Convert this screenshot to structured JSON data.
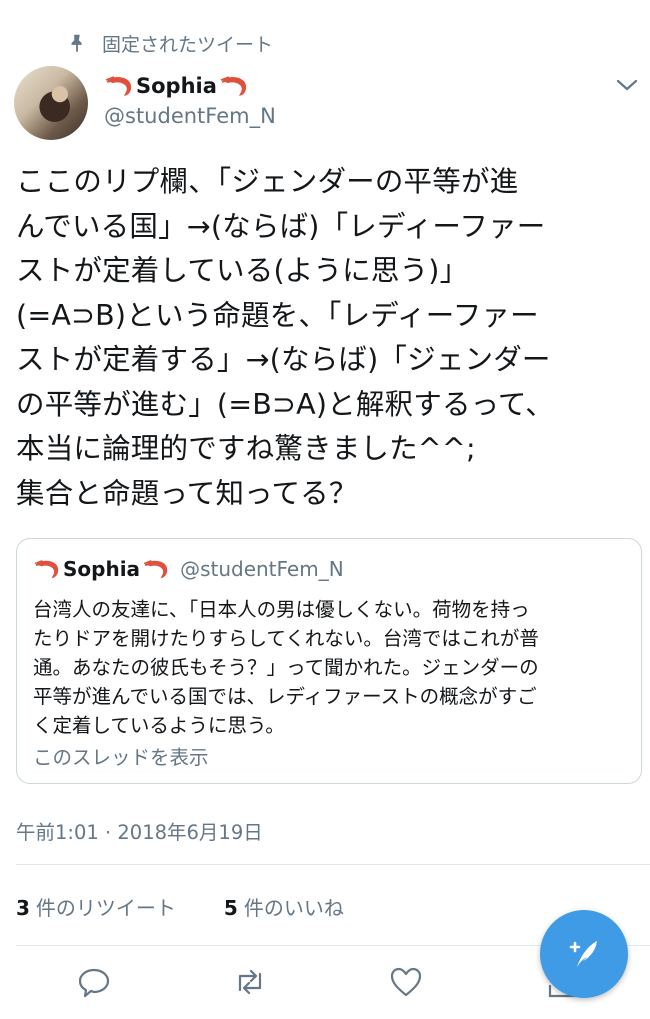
{
  "pinned_label": "固定されたツイート",
  "author": {
    "name": "Sophia",
    "handle": "@studentFem_N"
  },
  "tweet_text": "ここのリプ欄、「ジェンダーの平等が進\nんでいる国」→(ならば)「レディーファー\nストが定着している(ように思う)」\n(=A⊃B)という命題を、「レディーファー\nストが定着する」→(ならば)「ジェンダー\nの平等が進む」(=B⊃A)と解釈するって、\n本当に論理的ですね驚きました^^;\n集合と命題って知ってる？",
  "quote": {
    "name": "Sophia",
    "handle": "@studentFem_N",
    "text": "台湾人の友達に、「日本人の男は優しくない。荷物を持っ\nたりドアを開けたりすらしてくれない。台湾ではこれが普\n通。あなたの彼氏もそう？」って聞かれた。ジェンダーの\n平等が進んでいる国では、レディファーストの概念がすご\nく定着しているように思う。",
    "show_thread": "このスレッドを表示"
  },
  "timestamp": "午前1:01 · 2018年6月19日",
  "stats": {
    "retweets_count": "3",
    "retweets_label": "件のリツイート",
    "likes_count": "5",
    "likes_label": "件のいいね"
  },
  "icons": {
    "pin": "pin-icon",
    "caret": "chevron-down-icon",
    "reply": "reply-icon",
    "retweet": "retweet-icon",
    "like": "heart-icon",
    "share": "share-icon",
    "compose": "compose-tweet-icon",
    "name_emoji": "shrimp-icon"
  },
  "colors": {
    "text": "#14171a",
    "secondary": "#657786",
    "border": "#ccd6dd",
    "accent": "#3f9be6",
    "shrimp": "#e0503c"
  }
}
